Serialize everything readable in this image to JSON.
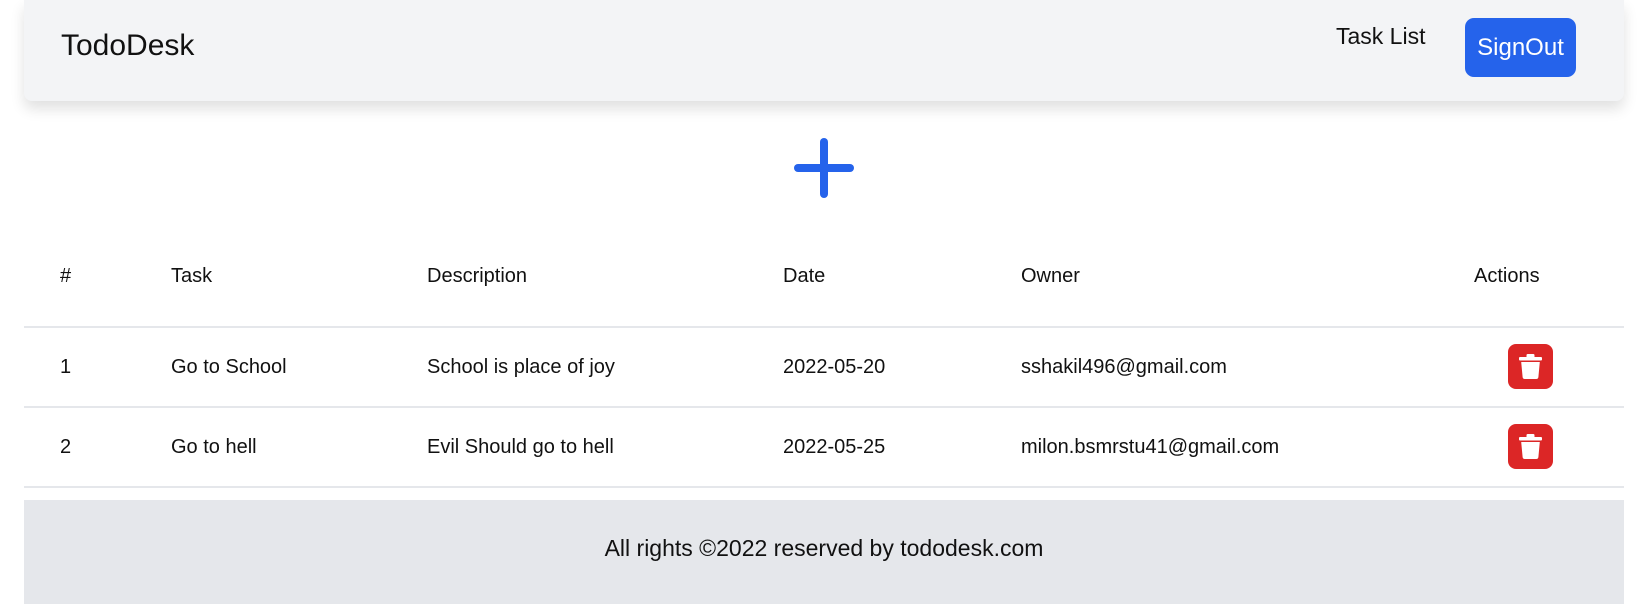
{
  "header": {
    "brand": "TodoDesk",
    "nav_link": "Task List",
    "signout_label": "SignOut"
  },
  "colors": {
    "accent": "#2563eb",
    "danger": "#dc2626",
    "navbar_bg": "#f3f4f6",
    "footer_bg": "#e5e7eb"
  },
  "add_button": {
    "icon": "plus-icon"
  },
  "table": {
    "columns": [
      "#",
      "Task",
      "Description",
      "Date",
      "Owner",
      "Actions"
    ],
    "rows": [
      {
        "num": "1",
        "task": "Go to School",
        "description": "School is place of joy",
        "date": "2022-05-20",
        "owner": "sshakil496@gmail.com",
        "action_icon": "trash-icon"
      },
      {
        "num": "2",
        "task": "Go to hell",
        "description": "Evil Should go to hell",
        "date": "2022-05-25",
        "owner": "milon.bsmrstu41@gmail.com",
        "action_icon": "trash-icon"
      }
    ]
  },
  "footer": {
    "text": "All rights ©2022 reserved by tododesk.com"
  }
}
